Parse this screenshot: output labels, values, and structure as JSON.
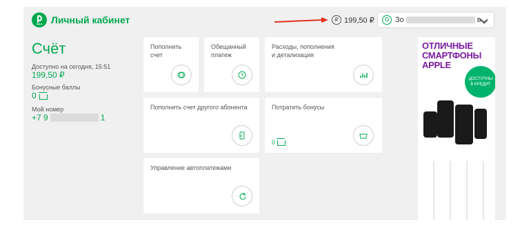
{
  "header": {
    "brand": "Личный кабинет",
    "balance": "199,50 ₽",
    "account_name_start": "Зо",
    "account_name_end": "в..."
  },
  "account": {
    "title": "Счёт",
    "available_label": "Доступно на сегодня, 15:51",
    "available_value": "199,50 ₽",
    "bonus_label": "Бонусные баллы",
    "bonus_value": "0",
    "number_label": "Мой номер",
    "number_start": "+7 9",
    "number_end": "1"
  },
  "cards": {
    "topup": "Пополнить\nсчет",
    "promised": "Обещанный\nплатеж",
    "expenses": "Расходы, пополнения\nи детализация",
    "topup_other": "Пополнить счет другого абонента",
    "spend_bonus": "Потратить бонусы",
    "spend_bonus_value": "0",
    "autopay": "Управление автоплатежами"
  },
  "ad": {
    "title": "ОТЛИЧНЫЕ\nСМАРТФОНЫ\nAPPLE",
    "badge": "ДОСТУПНЫ\nВ КРЕДИТ"
  },
  "colors": {
    "accent": "#00a94f",
    "ad_text": "#7a1aa0",
    "arrow": "#e0301e"
  }
}
